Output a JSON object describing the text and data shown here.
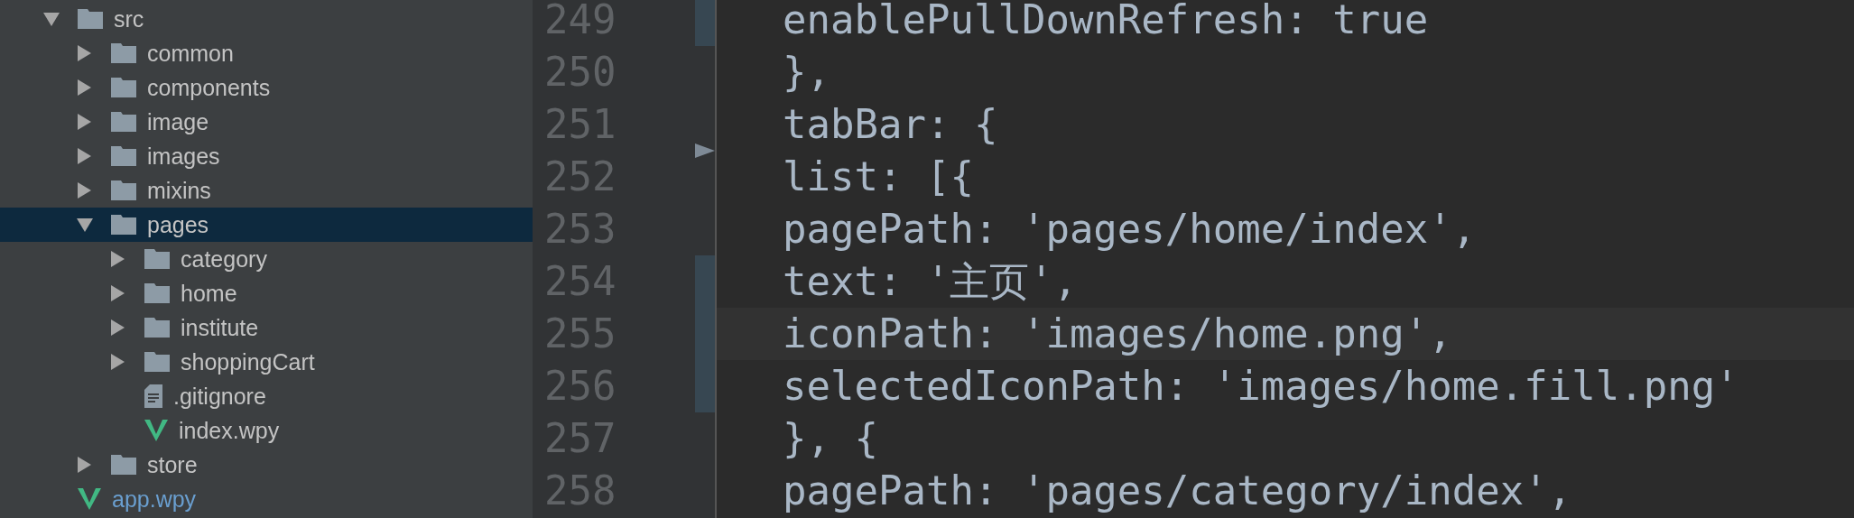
{
  "project_tree": [
    {
      "label": "src",
      "kind": "folder",
      "expanded": true,
      "selected": false,
      "modified": false,
      "children": [
        {
          "label": "common",
          "kind": "folder",
          "expanded": false,
          "selected": false,
          "modified": false
        },
        {
          "label": "components",
          "kind": "folder",
          "expanded": false,
          "selected": false,
          "modified": false
        },
        {
          "label": "image",
          "kind": "folder",
          "expanded": false,
          "selected": false,
          "modified": false
        },
        {
          "label": "images",
          "kind": "folder",
          "expanded": false,
          "selected": false,
          "modified": false
        },
        {
          "label": "mixins",
          "kind": "folder",
          "expanded": false,
          "selected": false,
          "modified": false
        },
        {
          "label": "pages",
          "kind": "folder",
          "expanded": true,
          "selected": true,
          "modified": false,
          "children": [
            {
              "label": "category",
              "kind": "folder",
              "expanded": false,
              "selected": false,
              "modified": false
            },
            {
              "label": "home",
              "kind": "folder",
              "expanded": false,
              "selected": false,
              "modified": false
            },
            {
              "label": "institute",
              "kind": "folder",
              "expanded": false,
              "selected": false,
              "modified": false
            },
            {
              "label": "shoppingCart",
              "kind": "folder",
              "expanded": false,
              "selected": false,
              "modified": false
            },
            {
              "label": ".gitignore",
              "kind": "text",
              "selected": false,
              "modified": false
            },
            {
              "label": "index.wpy",
              "kind": "vue",
              "selected": false,
              "modified": false
            }
          ]
        },
        {
          "label": "store",
          "kind": "folder",
          "expanded": false,
          "selected": false,
          "modified": false
        }
      ]
    },
    {
      "label": "app.wpy",
      "kind": "vue",
      "selected": false,
      "modified": true
    }
  ],
  "editor": {
    "lines": [
      {
        "number": "249",
        "code": "enablePullDownRefresh: true",
        "changed": true,
        "current": false,
        "fold": false
      },
      {
        "number": "250",
        "code": "},",
        "changed": false,
        "current": false,
        "fold": false
      },
      {
        "number": "251",
        "code": "tabBar: {",
        "changed": false,
        "current": false,
        "fold": false
      },
      {
        "number": "252",
        "code": "list: [{",
        "changed": false,
        "current": false,
        "fold": true
      },
      {
        "number": "253",
        "code": "pagePath: 'pages/home/index',",
        "changed": false,
        "current": false,
        "fold": false
      },
      {
        "number": "254",
        "code": "text: '主页',",
        "changed": true,
        "current": false,
        "fold": false
      },
      {
        "number": "255",
        "code": "iconPath: 'images/home.png',",
        "changed": true,
        "current": true,
        "fold": false
      },
      {
        "number": "256",
        "code": "selectedIconPath: 'images/home.fill.png'",
        "changed": true,
        "current": false,
        "fold": false
      },
      {
        "number": "257",
        "code": "}, {",
        "changed": false,
        "current": false,
        "fold": false
      },
      {
        "number": "258",
        "code": "pagePath: 'pages/category/index',",
        "changed": false,
        "current": false,
        "fold": false
      }
    ]
  }
}
